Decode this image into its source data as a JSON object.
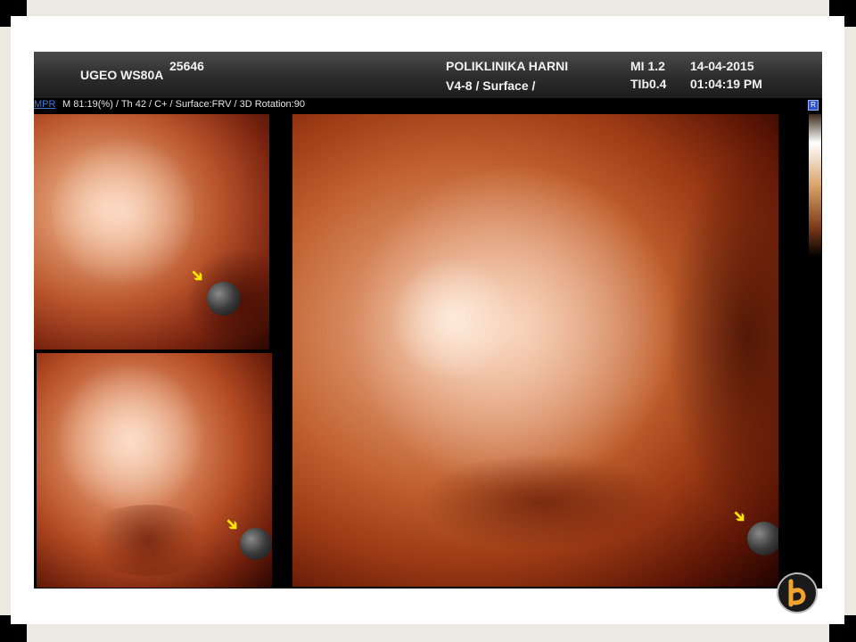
{
  "header": {
    "device": "UGEO WS80A",
    "id": "25646",
    "clinic": "POLIKLINIKA HARNI",
    "probe": "V4-8 / Surface /",
    "mi": "MI  1.2",
    "tib": "TIb0.4",
    "date": "14-04-2015",
    "time": "01:04:19 PM"
  },
  "infobar": {
    "mode_button": "MPR",
    "params": "M 81:19(%) / Th 42 / C+ / Surface:FRV / 3D Rotation:90",
    "corner_button": "R"
  },
  "panes": [
    {
      "name": "mpr-pane-top-left"
    },
    {
      "name": "mpr-pane-bottom-left"
    },
    {
      "name": "3d-render-pane"
    }
  ],
  "icons": {
    "marker": "reference-marker-icon",
    "arrow": "yellow-arrow-icon",
    "logo": "clinic-logo-icon"
  },
  "colors": {
    "header_text": "#f2f2f2",
    "accent": "#3f7ad8",
    "arrow": "#ffe500"
  }
}
